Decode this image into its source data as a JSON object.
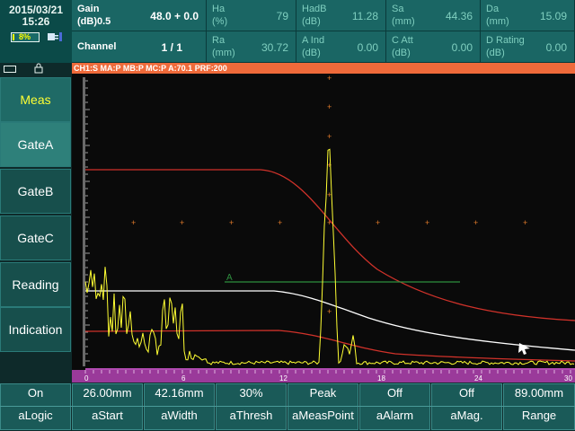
{
  "status": {
    "date": "2015/03/21",
    "time": "15:26",
    "battery": "8%",
    "battery_level": 0.08
  },
  "params": {
    "gain_label_1": "Gain",
    "gain_label_2": "(dB)0.5",
    "gain_value": "48.0 + 0.0",
    "channel_label": "Channel",
    "channel_value": "1 / 1",
    "ha_label_1": "Ha",
    "ha_label_2": "(%)",
    "ha_value": "79",
    "hadb_label_1": "HadB",
    "hadb_label_2": "(dB)",
    "hadb_value": "11.28",
    "sa_label_1": "Sa",
    "sa_label_2": "(mm)",
    "sa_value": "44.36",
    "da_label_1": "Da",
    "da_label_2": "(mm)",
    "da_value": "15.09",
    "ra_label_1": "Ra",
    "ra_label_2": "(mm)",
    "ra_value": "30.72",
    "aind_label_1": "A Ind",
    "aind_label_2": "(dB)",
    "aind_value": "0.00",
    "catt_label_1": "C Att",
    "catt_label_2": "(dB)",
    "catt_value": "0.00",
    "drating_label_1": "D Rating",
    "drating_label_2": "(dB)",
    "drating_value": "0.00"
  },
  "infobar": "CH1:S MA:P  MB:P  MC:P  A:70.1  PRF:200",
  "menu": {
    "items": [
      {
        "label": "Meas"
      },
      {
        "label": "GateA"
      },
      {
        "label": "GateB"
      },
      {
        "label": "GateC"
      },
      {
        "label": "Reading"
      },
      {
        "label": "Indication"
      }
    ]
  },
  "plot": {
    "gate_label": "A",
    "x_ticks": [
      "0",
      "6",
      "12",
      "18",
      "24",
      "30"
    ]
  },
  "buttons": [
    {
      "value": "On",
      "name": "aLogic"
    },
    {
      "value": "26.00mm",
      "name": "aStart"
    },
    {
      "value": "42.16mm",
      "name": "aWidth"
    },
    {
      "value": "30%",
      "name": "aThresh"
    },
    {
      "value": "Peak",
      "name": "aMeasPoint"
    },
    {
      "value": "Off",
      "name": "aAlarm"
    },
    {
      "value": "Off",
      "name": "aMag."
    },
    {
      "value": "89.00mm",
      "name": "Range"
    }
  ],
  "colors": {
    "accent": "#ef6a3a",
    "signal": "#ffff33",
    "dac_curve": "#d0322a",
    "tcg_curve": "#ffffff",
    "gate": "#2f8f3f"
  }
}
